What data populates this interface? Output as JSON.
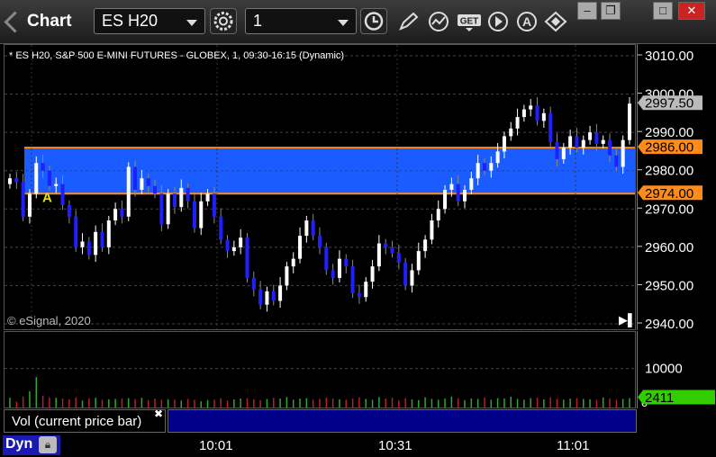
{
  "window": {
    "title": "Chart",
    "symbol": "ES H20",
    "interval": "1",
    "buttons": [
      "minimize",
      "restore",
      "maximize",
      "close"
    ]
  },
  "toolbar": {
    "icons": [
      "gear-icon",
      "clock-icon",
      "pencil-icon",
      "line-study-icon",
      "get-icon",
      "play-icon",
      "alert-icon",
      "diamond-tool-icon"
    ],
    "get_label": "GET"
  },
  "chart": {
    "description": "* ES H20, S&P 500 E-MINI FUTURES - GLOBEX, 1, 09:30-16:15 (Dynamic)",
    "copyright": "© eSignal, 2020",
    "marker_letter": "A",
    "scroll_end": "▶▌"
  },
  "colors": {
    "up": "#ffffff",
    "down": "#1f1fff",
    "zone": "#1a5cff",
    "zone_line": "#ff8c1a",
    "vol_up": "#2fa82f",
    "vol_down": "#b82020",
    "last_price_bg": "#bbbbbb",
    "vol_last_bg": "#33cc00"
  },
  "chart_data": {
    "type": "candlestick",
    "y_ticks": [
      "3010.00",
      "3000.00",
      "2990.00",
      "2980.00",
      "2970.00",
      "2960.00",
      "2950.00",
      "2940.00"
    ],
    "ylim": [
      2938,
      3012
    ],
    "price_labels": {
      "last": "2997.50",
      "upper_zone": "2986.00",
      "lower_zone": "2974.00"
    },
    "zone": [
      2974.0,
      2986.0
    ],
    "x_ticks": [
      "10:01",
      "10:31",
      "11:01"
    ],
    "vol_ticks": [
      "10000",
      "0"
    ],
    "vol_last": "2411",
    "vol_ylim": [
      0,
      18000
    ],
    "closes": [
      2978.0,
      2977.0,
      2968.0,
      2974.0,
      2982.0,
      2980.0,
      2976.0,
      2976.5,
      2971.0,
      2968.0,
      2960.0,
      2961.5,
      2958.0,
      2964.0,
      2960.0,
      2967.0,
      2970.0,
      2968.0,
      2981.0,
      2975.0,
      2978.0,
      2976.0,
      2974.0,
      2966.0,
      2974.0,
      2970.5,
      2975.5,
      2972.0,
      2965.0,
      2972.0,
      2974.0,
      2968.0,
      2962.0,
      2959.0,
      2960.0,
      2962.5,
      2952.0,
      2949.0,
      2945.0,
      2948.5,
      2946.0,
      2950.0,
      2955.0,
      2957.0,
      2963.0,
      2967.0,
      2963.0,
      2960.0,
      2954.0,
      2952.0,
      2957.0,
      2955.0,
      2948.0,
      2947.0,
      2951.0,
      2955.0,
      2961.0,
      2960.0,
      2958.5,
      2956.0,
      2950.0,
      2954.0,
      2959.0,
      2962.0,
      2967.0,
      2970.0,
      2975.0,
      2976.5,
      2972.0,
      2975.0,
      2978.0,
      2982.0,
      2980.0,
      2982.0,
      2985.0,
      2989.0,
      2991.0,
      2994.0,
      2996.0,
      2997.0,
      2993.0,
      2995.0,
      2987.5,
      2983.0,
      2986.0,
      2989.0,
      2986.0,
      2988.0,
      2990.0,
      2987.0,
      2988.0,
      2984.0,
      2981.0,
      2988.0,
      2997.5
    ],
    "volumes": [
      2500,
      1500,
      2800,
      4200,
      7800,
      3000,
      2600,
      2500,
      2300,
      2100,
      2600,
      1800,
      2400,
      2500,
      2000,
      2100,
      2200,
      2300,
      2400,
      2200,
      2500,
      1900,
      2300,
      2000,
      2100,
      2000,
      1800,
      2200,
      2000,
      1600,
      1900,
      2000,
      2400,
      1800,
      2100,
      2300,
      2400,
      2100,
      1900,
      2200,
      2500,
      2300,
      2700,
      2000,
      2300,
      2400,
      2000,
      2200,
      2500,
      2300,
      2100,
      2000,
      2300,
      2600,
      2200,
      2000,
      2700,
      2300,
      2500,
      1800,
      2400,
      2100,
      1900,
      2600,
      2200,
      2000,
      2300,
      2800,
      2400,
      1900,
      2300,
      2200,
      2600,
      2000,
      2400,
      2300,
      2800,
      2200,
      2000,
      2400,
      2500,
      2100,
      2600,
      2200,
      2000,
      2300,
      2400,
      2200,
      2100,
      2000,
      2600,
      2300,
      2000,
      2200,
      2411
    ]
  }
}
